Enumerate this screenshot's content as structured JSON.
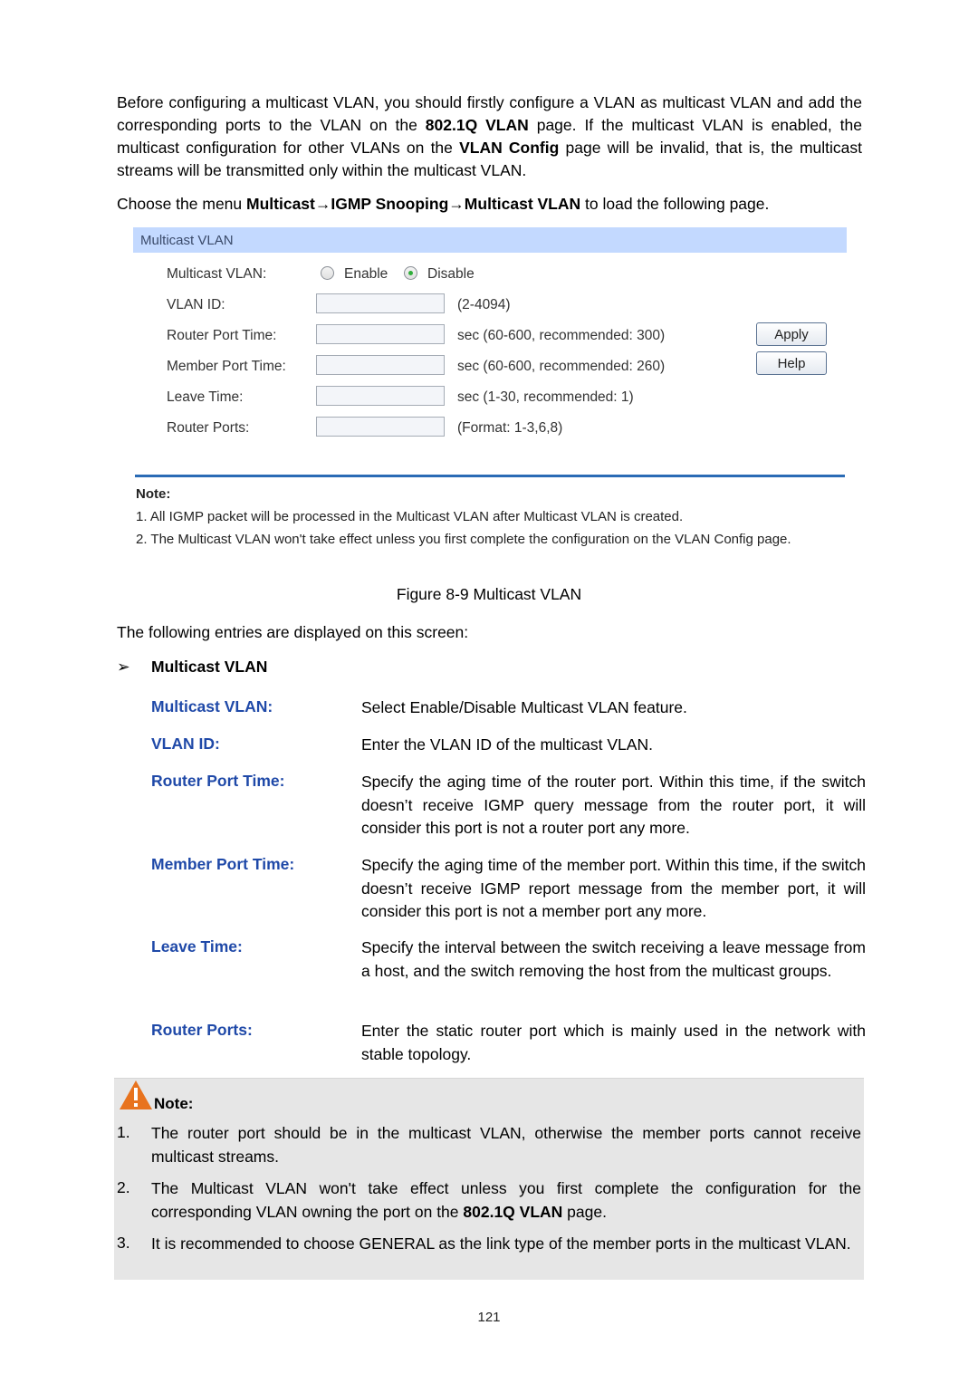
{
  "intro": {
    "p1_parts": [
      {
        "t": "Before configuring a multicast VLAN, you should firstly configure a VLAN as multicast VLAN and add the corresponding ports to the VLAN on the ",
        "b": false
      },
      {
        "t": "802.1Q VLAN",
        "b": true
      },
      {
        "t": " page. If the multicast VLAN is enabled, the multicast configuration for other VLANs on the ",
        "b": false
      },
      {
        "t": "VLAN Config",
        "b": true
      },
      {
        "t": " page will be invalid, that is, the multicast streams will be transmitted only within the multicast VLAN.",
        "b": false
      }
    ],
    "p2_parts": [
      {
        "t": "Choose the menu ",
        "b": false
      },
      {
        "t": "Multicast→IGMP Snooping→Multicast VLAN",
        "b": true
      },
      {
        "t": " to load the following page.",
        "b": false
      }
    ]
  },
  "screenshot": {
    "header": "Multicast VLAN",
    "multicast_vlan_label": "Multicast VLAN:",
    "radio_options": [
      {
        "label": "Enable",
        "checked": false
      },
      {
        "label": "Disable",
        "checked": true
      }
    ],
    "fields": [
      {
        "label": "VLAN ID:",
        "value": "",
        "hint": "(2-4094)"
      },
      {
        "label": "Router Port Time:",
        "value": "",
        "hint": "sec (60-600, recommended: 300)"
      },
      {
        "label": "Member Port Time:",
        "value": "",
        "hint": "sec (60-600, recommended: 260)"
      },
      {
        "label": "Leave Time:",
        "value": "",
        "hint": "sec (1-30, recommended: 1)"
      },
      {
        "label": "Router Ports:",
        "value": "",
        "hint": "(Format: 1-3,6,8)"
      }
    ],
    "buttons": {
      "apply": "Apply",
      "help": "Help"
    },
    "note_title": "Note:",
    "notes": [
      "1. All IGMP packet will be processed in the Multicast VLAN after Multicast VLAN is created.",
      "2. The Multicast VLAN won't take effect unless you first complete the configuration on the VLAN Config page."
    ]
  },
  "caption": "Figure 8-9 Multicast VLAN",
  "entries_intro": "The following entries are displayed on this screen:",
  "section": {
    "bullet": "➢",
    "title": "Multicast VLAN"
  },
  "definitions": [
    {
      "term": "Multicast VLAN:",
      "desc": "Select Enable/Disable Multicast VLAN feature."
    },
    {
      "term": "VLAN ID:",
      "desc": "Enter the VLAN ID of the multicast VLAN."
    },
    {
      "term": "Router Port Time:",
      "desc": "Specify the aging time of the router port. Within this time, if the switch doesn’t receive IGMP query message from the router port, it will consider this port is not a router port any more."
    },
    {
      "term": "Member Port Time:",
      "desc": "Specify the aging time of the member port. Within this time, if the switch doesn’t receive IGMP report message from the member port, it will consider this port is not a member port any more."
    },
    {
      "term": "Leave Time:",
      "desc": "Specify the interval between the switch receiving a leave message from a host, and the switch removing the host from the multicast groups."
    },
    {
      "term": "Router Ports:",
      "desc": "Enter the static router port which is mainly used in the network with stable topology."
    }
  ],
  "note": {
    "title": "Note:",
    "items": [
      {
        "num": "1.",
        "parts": [
          {
            "t": "The router port should be in the multicast VLAN, otherwise the member ports cannot receive multicast streams.",
            "b": false
          }
        ]
      },
      {
        "num": "2.",
        "parts": [
          {
            "t": "The Multicast VLAN won't take effect unless you first complete the configuration for the corresponding VLAN owning the port on the ",
            "b": false
          },
          {
            "t": "802.1Q VLAN",
            "b": true
          },
          {
            "t": " page.",
            "b": false
          }
        ]
      },
      {
        "num": "3.",
        "parts": [
          {
            "t": "It is recommended to choose GENERAL as the link type of the member ports in the multicast VLAN.",
            "b": false
          }
        ]
      }
    ]
  },
  "page_number": "121",
  "colors": {
    "term_blue": "#1f49a8",
    "header_bg": "#c3d9ff",
    "divider_blue": "#2a6bb5",
    "note_bg": "#e6e6e6",
    "warn_orange": "#e8731e"
  }
}
